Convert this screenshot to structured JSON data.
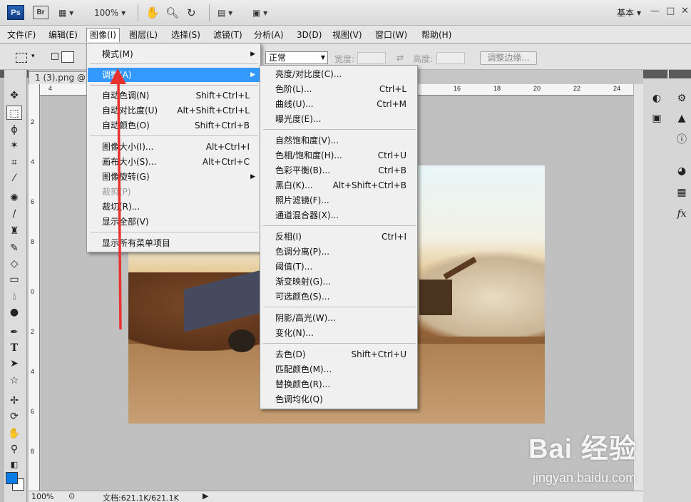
{
  "app": {
    "logo": "Ps",
    "bridge": "Br",
    "zoom": "100%",
    "workspace": "基本",
    "window_controls": [
      "—",
      "□",
      "✕"
    ]
  },
  "menubar": [
    "文件(F)",
    "编辑(E)",
    "图像(I)",
    "图层(L)",
    "选择(S)",
    "滤镜(T)",
    "分析(A)",
    "3D(D)",
    "视图(V)",
    "窗口(W)",
    "帮助(H)"
  ],
  "options": {
    "mode_value": "正常",
    "width_label": "宽度:",
    "height_label": "高度:",
    "refine_edge": "调整边缘..."
  },
  "document": {
    "tab": "1 (3).png @ 1",
    "ruler_top": [
      "4",
      "16",
      "18",
      "20",
      "22",
      "24"
    ],
    "ruler_left": [
      "2",
      "4",
      "6",
      "8",
      "0",
      "2",
      "4",
      "6",
      "8",
      "2",
      "4"
    ]
  },
  "image_menu": {
    "items": [
      {
        "label": "模式(M)",
        "shortcut": "",
        "submenu": true
      },
      {
        "label": "调整(A)",
        "shortcut": "",
        "submenu": true,
        "highlighted": true
      },
      {
        "label": "自动色调(N)",
        "shortcut": "Shift+Ctrl+L"
      },
      {
        "label": "自动对比度(U)",
        "shortcut": "Alt+Shift+Ctrl+L"
      },
      {
        "label": "自动颜色(O)",
        "shortcut": "Shift+Ctrl+B"
      },
      {
        "label": "图像大小(I)...",
        "shortcut": "Alt+Ctrl+I"
      },
      {
        "label": "画布大小(S)...",
        "shortcut": "Alt+Ctrl+C"
      },
      {
        "label": "图像旋转(G)",
        "shortcut": "",
        "submenu": true
      },
      {
        "label": "裁剪(P)",
        "shortcut": "",
        "disabled": true
      },
      {
        "label": "裁切(R)...",
        "shortcut": ""
      },
      {
        "label": "显示全部(V)",
        "shortcut": ""
      },
      {
        "label": "显示所有菜单项目",
        "shortcut": ""
      }
    ]
  },
  "adjust_menu": {
    "items": [
      {
        "label": "亮度/对比度(C)...",
        "shortcut": ""
      },
      {
        "label": "色阶(L)...",
        "shortcut": "Ctrl+L"
      },
      {
        "label": "曲线(U)...",
        "shortcut": "Ctrl+M"
      },
      {
        "label": "曝光度(E)...",
        "shortcut": ""
      },
      {
        "label": "自然饱和度(V)...",
        "shortcut": ""
      },
      {
        "label": "色相/饱和度(H)...",
        "shortcut": "Ctrl+U"
      },
      {
        "label": "色彩平衡(B)...",
        "shortcut": "Ctrl+B"
      },
      {
        "label": "黑白(K)...",
        "shortcut": "Alt+Shift+Ctrl+B"
      },
      {
        "label": "照片滤镜(F)...",
        "shortcut": ""
      },
      {
        "label": "通道混合器(X)...",
        "shortcut": ""
      },
      {
        "label": "反相(I)",
        "shortcut": "Ctrl+I"
      },
      {
        "label": "色调分离(P)...",
        "shortcut": ""
      },
      {
        "label": "阈值(T)...",
        "shortcut": ""
      },
      {
        "label": "渐变映射(G)...",
        "shortcut": ""
      },
      {
        "label": "可选颜色(S)...",
        "shortcut": ""
      },
      {
        "label": "阴影/高光(W)...",
        "shortcut": ""
      },
      {
        "label": "变化(N)...",
        "shortcut": ""
      },
      {
        "label": "去色(D)",
        "shortcut": "Shift+Ctrl+U"
      },
      {
        "label": "匹配颜色(M)...",
        "shortcut": ""
      },
      {
        "label": "替换颜色(R)...",
        "shortcut": ""
      },
      {
        "label": "色调均化(Q)",
        "shortcut": ""
      }
    ]
  },
  "status": {
    "zoom": "100%",
    "doc_info": "文档:621.1K/621.1K"
  },
  "watermark": {
    "logo": "Bai 经验",
    "url": "jingyan.baidu.com"
  },
  "colors": {
    "highlight": "#3399ff",
    "foreground_swatch": "#0b7de8",
    "annotation_arrow": "#e8322f"
  }
}
